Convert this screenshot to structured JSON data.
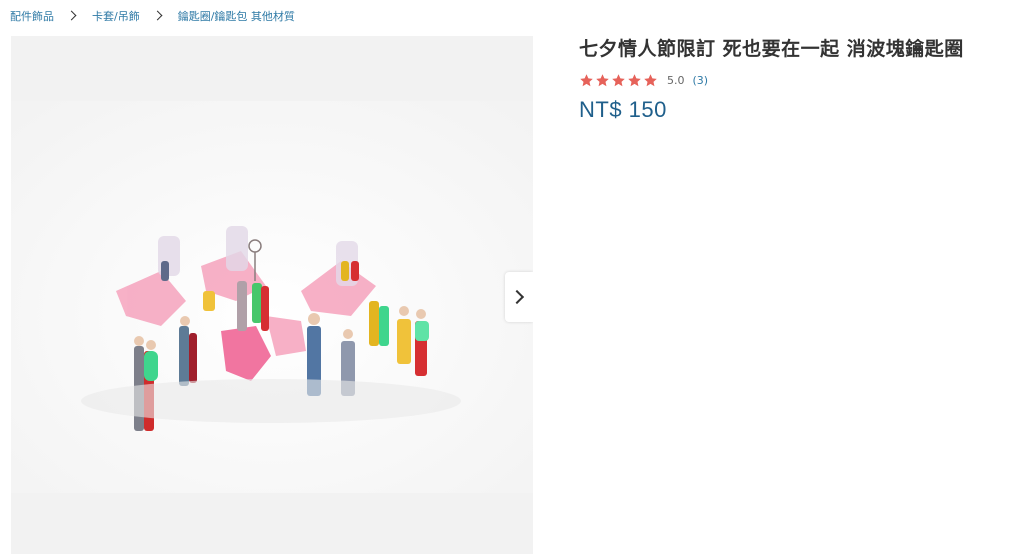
{
  "breadcrumb": {
    "items": [
      "配件飾品",
      "卡套/吊飾",
      "鑰匙圈/鑰匙包 其他材質"
    ]
  },
  "product": {
    "title": "七夕情人節限訂 死也要在一起 消波塊鑰匙圈",
    "rating_score": "5.0",
    "rating_count": "(3)",
    "rating_stars": 5,
    "price": "NT$ 150"
  },
  "colors": {
    "link": "#2f7aa6",
    "price": "#1f5f8b",
    "star": "#e6625a"
  },
  "icons": {
    "next": "chevron-right-icon",
    "star": "star-icon",
    "separator": "chevron-right-icon"
  }
}
